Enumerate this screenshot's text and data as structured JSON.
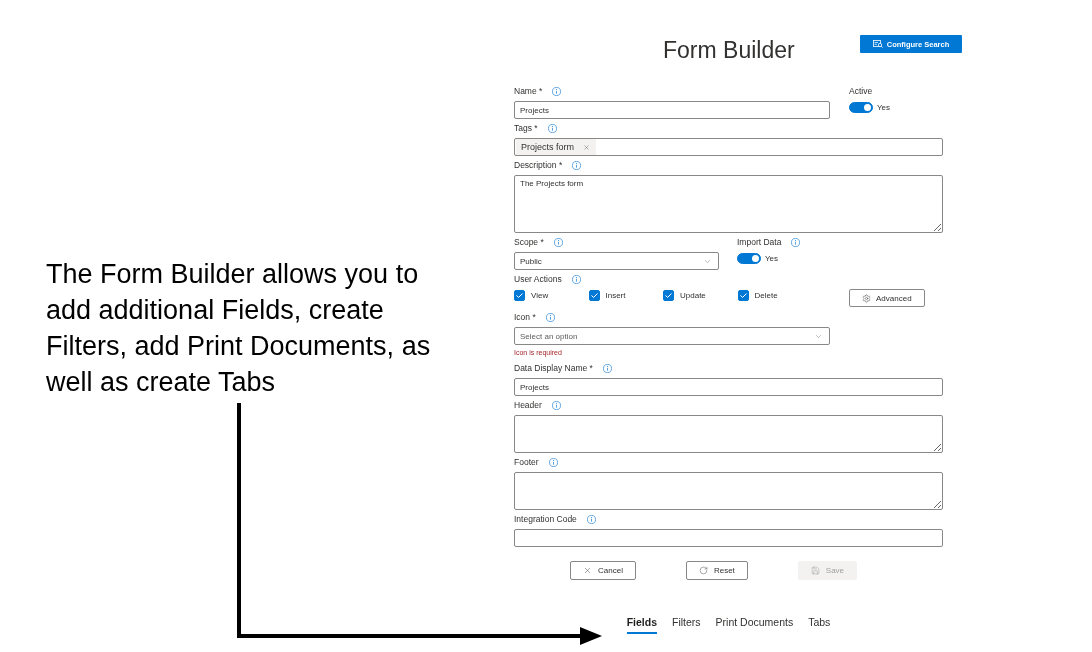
{
  "annotation": {
    "text": "The Form Builder allows you to add additional Fields, create Filters, add Print Documents, as well as create Tabs"
  },
  "header": {
    "title": "Form Builder",
    "configure_button": "Configure Search"
  },
  "form": {
    "name": {
      "label": "Name *",
      "value": "Projects"
    },
    "active": {
      "label": "Active",
      "on": true,
      "state_text": "Yes"
    },
    "tags": {
      "label": "Tags *",
      "chips": [
        {
          "label": "Projects form"
        }
      ]
    },
    "description": {
      "label": "Description *",
      "value": "The Projects form"
    },
    "scope": {
      "label": "Scope *",
      "value": "Public"
    },
    "import_data": {
      "label": "Import Data",
      "on": true,
      "state_text": "Yes"
    },
    "user_actions": {
      "label": "User Actions",
      "options": [
        {
          "label": "View",
          "checked": true
        },
        {
          "label": "Insert",
          "checked": true
        },
        {
          "label": "Update",
          "checked": true
        },
        {
          "label": "Delete",
          "checked": true
        }
      ]
    },
    "advanced_button": "Advanced",
    "icon": {
      "label": "Icon *",
      "placeholder": "Select an option",
      "error": "Icon is required"
    },
    "data_display_name": {
      "label": "Data Display Name *",
      "value": "Projects"
    },
    "header": {
      "label": "Header"
    },
    "footer": {
      "label": "Footer"
    },
    "integration_code": {
      "label": "Integration Code"
    }
  },
  "actions": [
    {
      "kind": "cancel",
      "label": "Cancel",
      "disabled": false
    },
    {
      "kind": "reset",
      "label": "Reset",
      "disabled": false
    },
    {
      "kind": "save",
      "label": "Save",
      "disabled": true
    }
  ],
  "tabs": [
    {
      "label": "Fields",
      "selected": true
    },
    {
      "label": "Filters",
      "selected": false
    },
    {
      "label": "Print Documents",
      "selected": false
    },
    {
      "label": "Tabs",
      "selected": false
    }
  ]
}
